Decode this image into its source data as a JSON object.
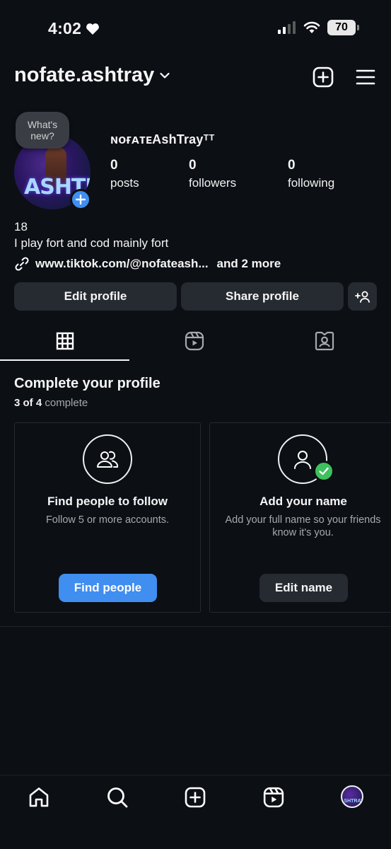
{
  "status_bar": {
    "time": "4:02",
    "battery": "70"
  },
  "header": {
    "username": "nofate.ashtray"
  },
  "profile": {
    "note": "What's new?",
    "avatar_text": "ASHTRAY",
    "display_name": "ɴᴏғᴀᴛᴇAshTrayᵀᵀ",
    "stats": [
      {
        "num": "0",
        "label": "posts"
      },
      {
        "num": "0",
        "label": "followers"
      },
      {
        "num": "0",
        "label": "following"
      }
    ],
    "bio_line1": "18",
    "bio_line2": "I play fort and cod mainly fort",
    "link": "www.tiktok.com/@nofateash...",
    "link_more": "and 2 more"
  },
  "buttons": {
    "edit": "Edit profile",
    "share": "Share profile"
  },
  "complete": {
    "title": "Complete your profile",
    "progress_done": "3 of 4",
    "progress_word": "complete",
    "cards": [
      {
        "title": "Find people to follow",
        "subtitle": "Follow 5 or more accounts.",
        "button": "Find people"
      },
      {
        "title": "Add your name",
        "subtitle": "Add your full name so your friends know it's you.",
        "button": "Edit name"
      }
    ]
  },
  "icons": {
    "header": [
      "new-post-icon",
      "menu-icon"
    ],
    "tabs": [
      "grid-icon",
      "reels-icon",
      "tagged-icon"
    ],
    "nav": [
      "home-icon",
      "search-icon",
      "create-icon",
      "reels-icon",
      "profile-avatar"
    ]
  },
  "colors": {
    "accent": "#3f8ef0",
    "check": "#3ec15d",
    "button_bg": "#262a31",
    "bg": "#0c0f14"
  }
}
